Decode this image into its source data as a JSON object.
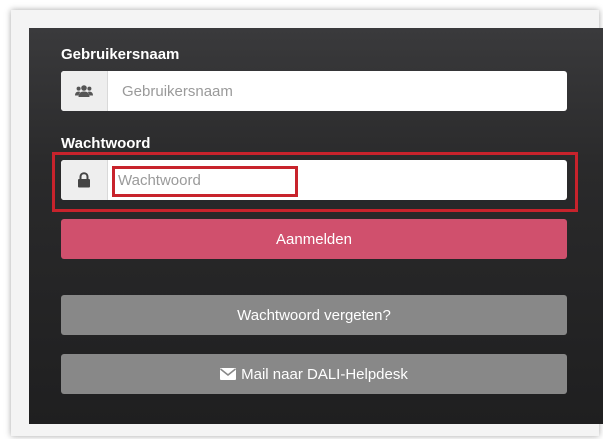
{
  "username": {
    "label": "Gebruikersnaam",
    "placeholder": "Gebruikersnaam",
    "icon": "users-icon"
  },
  "password": {
    "label": "Wachtwoord",
    "placeholder": "Wachtwoord",
    "icon": "lock-icon"
  },
  "buttons": {
    "login": "Aanmelden",
    "forgot": "Wachtwoord vergeten?",
    "mail": "Mail naar DALI-Helpdesk"
  },
  "colors": {
    "login_button": "#d0506d",
    "secondary_button": "#888888",
    "highlight": "#c8232c",
    "panel": "#2a2a2b"
  }
}
